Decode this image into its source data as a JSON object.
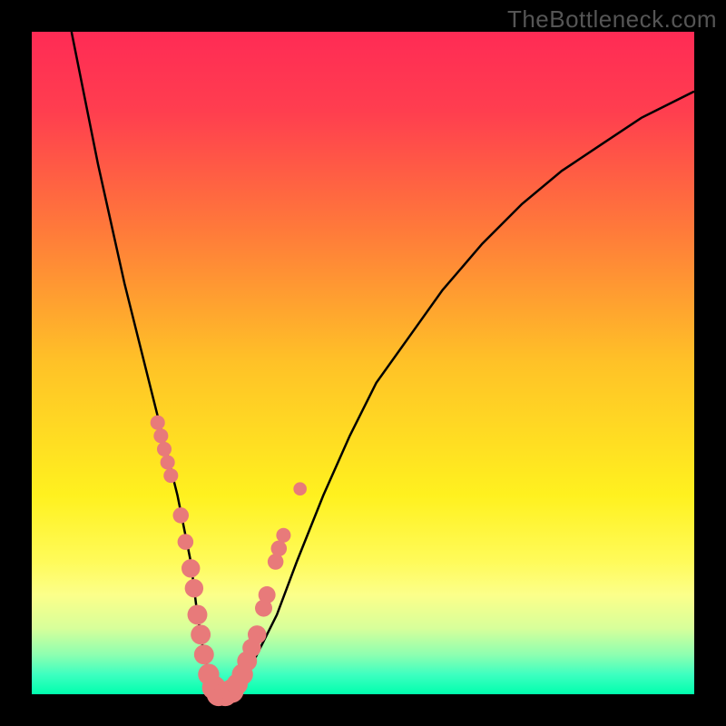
{
  "watermark": "TheBottleneck.com",
  "colors": {
    "gradient_stops": [
      {
        "pos": 0.0,
        "color": "#ff2b55"
      },
      {
        "pos": 0.12,
        "color": "#ff3e4f"
      },
      {
        "pos": 0.3,
        "color": "#ff7a3a"
      },
      {
        "pos": 0.5,
        "color": "#ffc227"
      },
      {
        "pos": 0.7,
        "color": "#fff11f"
      },
      {
        "pos": 0.8,
        "color": "#fffb5a"
      },
      {
        "pos": 0.85,
        "color": "#fcff8a"
      },
      {
        "pos": 0.9,
        "color": "#d8ff9a"
      },
      {
        "pos": 0.94,
        "color": "#8effb0"
      },
      {
        "pos": 0.97,
        "color": "#3effc0"
      },
      {
        "pos": 1.0,
        "color": "#00ffae"
      }
    ],
    "curve": "#000000",
    "bead": "#e87a7a",
    "frame": "#000000"
  },
  "chart_data": {
    "type": "line",
    "title": "",
    "xlabel": "",
    "ylabel": "",
    "xlim": [
      0,
      100
    ],
    "ylim": [
      0,
      100
    ],
    "grid": false,
    "legend": false,
    "series": [
      {
        "name": "bottleneck-curve",
        "x": [
          6,
          8,
          10,
          12,
          14,
          16,
          18,
          20,
          22,
          24,
          25,
          26,
          27,
          28,
          30,
          32,
          34,
          37,
          40,
          44,
          48,
          52,
          57,
          62,
          68,
          74,
          80,
          86,
          92,
          100
        ],
        "y": [
          100,
          90,
          80,
          71,
          62,
          54,
          46,
          38,
          30,
          20,
          12,
          6,
          2,
          0,
          0,
          2,
          6,
          12,
          20,
          30,
          39,
          47,
          54,
          61,
          68,
          74,
          79,
          83,
          87,
          91
        ]
      }
    ],
    "markers": [
      {
        "name": "bead",
        "x": 19.0,
        "y": 41,
        "r": 1.1
      },
      {
        "name": "bead",
        "x": 19.5,
        "y": 39,
        "r": 1.1
      },
      {
        "name": "bead",
        "x": 20.0,
        "y": 37,
        "r": 1.1
      },
      {
        "name": "bead",
        "x": 20.5,
        "y": 35,
        "r": 1.1
      },
      {
        "name": "bead",
        "x": 21.0,
        "y": 33,
        "r": 1.1
      },
      {
        "name": "bead",
        "x": 22.5,
        "y": 27,
        "r": 1.2
      },
      {
        "name": "bead",
        "x": 23.2,
        "y": 23,
        "r": 1.2
      },
      {
        "name": "bead",
        "x": 24.0,
        "y": 19,
        "r": 1.4
      },
      {
        "name": "bead",
        "x": 24.5,
        "y": 16,
        "r": 1.4
      },
      {
        "name": "bead",
        "x": 25.0,
        "y": 12,
        "r": 1.5
      },
      {
        "name": "bead",
        "x": 25.5,
        "y": 9,
        "r": 1.5
      },
      {
        "name": "bead",
        "x": 26.0,
        "y": 6,
        "r": 1.5
      },
      {
        "name": "bead",
        "x": 26.7,
        "y": 3,
        "r": 1.6
      },
      {
        "name": "bead",
        "x": 27.5,
        "y": 1,
        "r": 1.8
      },
      {
        "name": "bead",
        "x": 28.2,
        "y": 0,
        "r": 1.8
      },
      {
        "name": "bead",
        "x": 29.2,
        "y": 0,
        "r": 1.8
      },
      {
        "name": "bead",
        "x": 30.2,
        "y": 0.5,
        "r": 1.8
      },
      {
        "name": "bead",
        "x": 31.0,
        "y": 1.5,
        "r": 1.6
      },
      {
        "name": "bead",
        "x": 31.8,
        "y": 3,
        "r": 1.6
      },
      {
        "name": "bead",
        "x": 32.5,
        "y": 5,
        "r": 1.5
      },
      {
        "name": "bead",
        "x": 33.2,
        "y": 7,
        "r": 1.4
      },
      {
        "name": "bead",
        "x": 34.0,
        "y": 9,
        "r": 1.4
      },
      {
        "name": "bead",
        "x": 35.0,
        "y": 13,
        "r": 1.3
      },
      {
        "name": "bead",
        "x": 35.5,
        "y": 15,
        "r": 1.3
      },
      {
        "name": "bead",
        "x": 36.8,
        "y": 20,
        "r": 1.2
      },
      {
        "name": "bead",
        "x": 37.3,
        "y": 22,
        "r": 1.2
      },
      {
        "name": "bead",
        "x": 38.0,
        "y": 24,
        "r": 1.1
      },
      {
        "name": "bead",
        "x": 40.5,
        "y": 31,
        "r": 1.0
      }
    ]
  }
}
